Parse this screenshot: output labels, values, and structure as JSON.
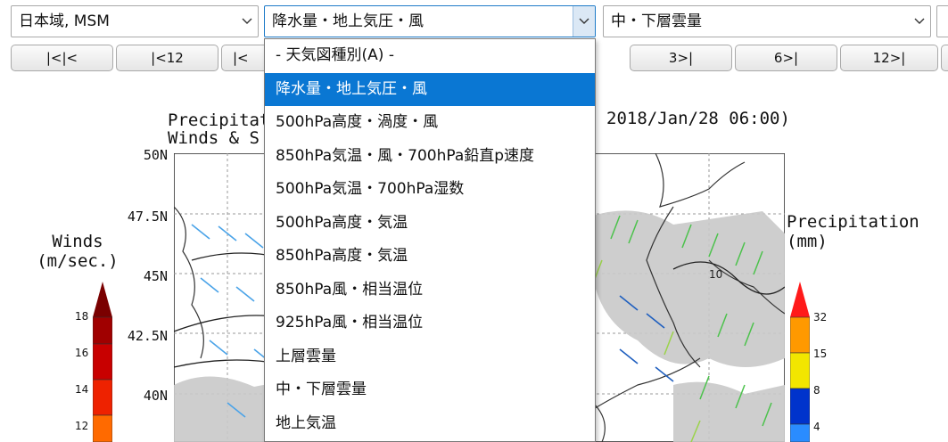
{
  "selects": {
    "region": "日本域, MSM",
    "product": "降水量・地上気圧・風",
    "secondary": "中・下層雲量"
  },
  "nav_buttons": [
    "|<|<",
    "|<12",
    "|<",
    "3>|",
    "6>|",
    "12>|"
  ],
  "chart": {
    "title_line1": "Precipitati",
    "title_line2": "Winds & S",
    "title_time": "2018/Jan/28 06:00)",
    "latitudes": [
      "50N",
      "47.5N",
      "45N",
      "42.5N",
      "40N"
    ],
    "wind_legend": {
      "title": "Winds\n(m/sec.)",
      "ticks": [
        "18",
        "16",
        "14",
        "12"
      ]
    },
    "precip_legend": {
      "title": "Precipitation\n(mm)",
      "ticks": [
        "32",
        "15",
        "8",
        "4"
      ]
    },
    "contour_label": "10"
  },
  "dropdown": {
    "items": [
      "- 天気図種別(A) -",
      "降水量・地上気圧・風",
      "500hPa高度・渦度・風",
      "850hPa気温・風・700hPa鉛直p速度",
      "500hPa気温・700hPa湿数",
      "500hPa高度・気温",
      "850hPa高度・気温",
      "850hPa風・相当温位",
      "925hPa風・相当温位",
      "上層雲量",
      "中・下層雲量",
      "地上気温"
    ],
    "selected_index": 1
  },
  "colors": {
    "selected_bg": "#0a77d3",
    "focus_border": "#1e7bc8"
  }
}
